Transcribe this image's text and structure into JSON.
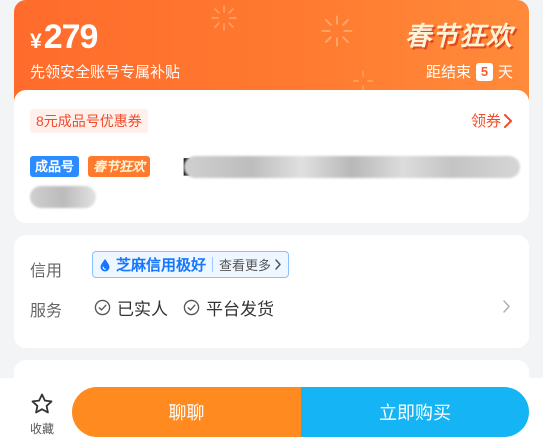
{
  "banner": {
    "currency": "¥",
    "price": "279",
    "subtitle": "先领安全账号专属补贴",
    "festival_title": "春节狂欢",
    "countdown_prefix": "距结束",
    "countdown_days": "5",
    "countdown_suffix": "天",
    "colors": {
      "gradient_start": "#ff6b2c",
      "gradient_end": "#ff8a3a"
    }
  },
  "coupon": {
    "tag": "8元成品号优惠券",
    "claim_label": "领券"
  },
  "product": {
    "badge_ready": "成品号",
    "badge_festival": "春节狂欢",
    "title_open_bracket": "【"
  },
  "info": {
    "credit_label": "信用",
    "credit_level": "芝麻信用极好",
    "credit_more": "查看更多",
    "service_label": "服务",
    "services": [
      "已实人",
      "平台发货"
    ]
  },
  "actions": {
    "favorite_label": "收藏",
    "chat_label": "聊聊",
    "buy_label": "立即购买",
    "colors": {
      "chat": "#ff8a1f",
      "buy": "#14b4f5"
    }
  },
  "icons": {
    "claim": "chevron-right-icon",
    "credit": "water-drop-icon",
    "service": "check-circle-icon",
    "service_more": "chevron-right-icon",
    "favorite": "star-outline-icon"
  }
}
